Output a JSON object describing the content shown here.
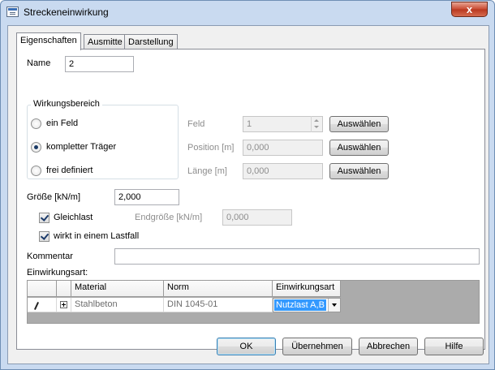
{
  "window": {
    "title": "Streckeneinwirkung",
    "close_label": "x"
  },
  "tabs": [
    {
      "label": "Eigenschaften",
      "active": true
    },
    {
      "label": "Ausmitte",
      "active": false
    },
    {
      "label": "Darstellung",
      "active": false
    }
  ],
  "name": {
    "label": "Name",
    "value": "2"
  },
  "wirkungsbereich": {
    "title": "Wirkungsbereich",
    "options": [
      {
        "label": "ein Feld",
        "checked": false
      },
      {
        "label": "kompletter Träger",
        "checked": true
      },
      {
        "label": "frei definiert",
        "checked": false
      }
    ],
    "feld": {
      "label": "Feld",
      "value": "1",
      "button": "Auswählen"
    },
    "position": {
      "label": "Position [m]",
      "value": "0,000",
      "button": "Auswählen"
    },
    "laenge": {
      "label": "Länge [m]",
      "value": "0,000",
      "button": "Auswählen"
    }
  },
  "groesse": {
    "label": "Größe [kN/m]",
    "value": "2,000"
  },
  "gleichlast": {
    "label": "Gleichlast",
    "checked": true
  },
  "endgroesse": {
    "label": "Endgröße [kN/m]",
    "value": "0,000"
  },
  "lastfall": {
    "label": "wirkt in einem Lastfall",
    "checked": true
  },
  "kommentar": {
    "label": "Kommentar",
    "value": ""
  },
  "einwirkungsart": {
    "label": "Einwirkungsart:",
    "columns": [
      "Material",
      "Norm",
      "Einwirkungsart"
    ],
    "rows": [
      {
        "material": "Stahlbeton",
        "norm": "DIN 1045-01",
        "einwirkungsart": "Nutzlast A,B"
      }
    ]
  },
  "buttons": {
    "ok": "OK",
    "apply": "Übernehmen",
    "cancel": "Abbrechen",
    "help": "Hilfe"
  },
  "colors": {
    "frame": "#c9daf0",
    "close_button": "#c8482f",
    "selection": "#3399ff"
  }
}
